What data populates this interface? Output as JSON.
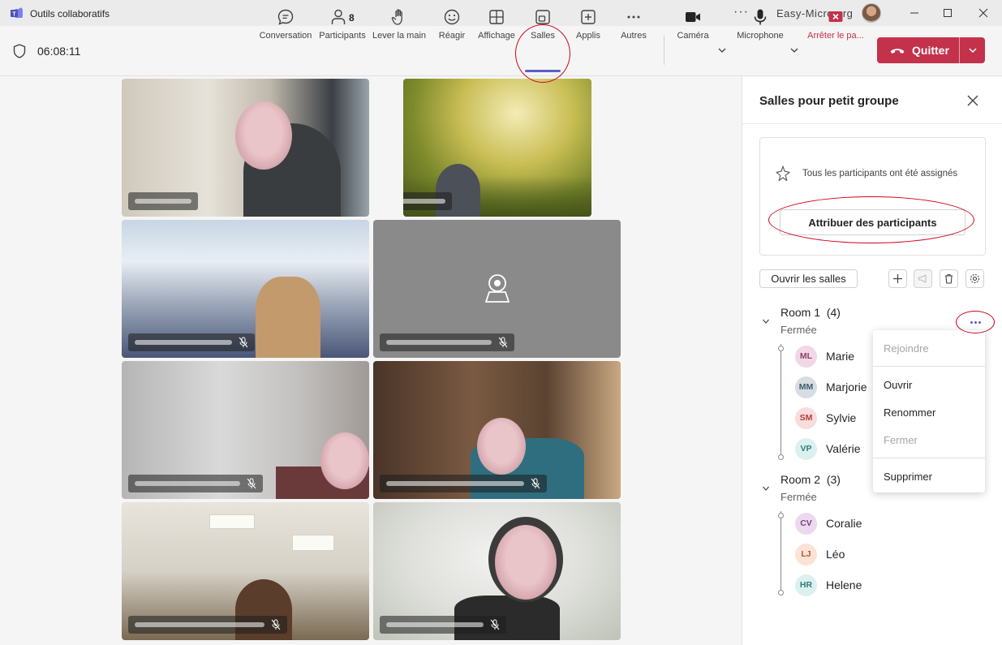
{
  "window": {
    "title": "Outils collaboratifs",
    "more_label": "···",
    "org": "Easy-Micro.org"
  },
  "toolbar": {
    "timer": "06:08:11",
    "items": [
      {
        "label": "Conversation",
        "icon": "chat-icon"
      },
      {
        "label": "Participants",
        "icon": "people-icon",
        "count": "8"
      },
      {
        "label": "Lever la main",
        "icon": "raise-hand-icon"
      },
      {
        "label": "Réagir",
        "icon": "smiley-icon"
      },
      {
        "label": "Affichage",
        "icon": "grid-view-icon"
      },
      {
        "label": "Salles",
        "icon": "breakout-rooms-icon"
      },
      {
        "label": "Applis",
        "icon": "add-apps-icon"
      },
      {
        "label": "Autres",
        "icon": "more-icon"
      },
      {
        "label": "Caméra",
        "icon": "camera-icon"
      },
      {
        "label": "Microphone",
        "icon": "microphone-icon"
      },
      {
        "label": "Arrêter le pa...",
        "icon": "stop-share-icon"
      }
    ],
    "quit_label": "Quitter",
    "accent": "#5b5fc7",
    "danger": "#c4314b"
  },
  "panel": {
    "title": "Salles pour petit groupe",
    "assigned_msg": "Tous les participants ont été assignés",
    "assign_button": "Attribuer des participants",
    "open_rooms_button": "Ouvrir les salles",
    "rooms": [
      {
        "name": "Room 1",
        "count": "(4)",
        "status": "Fermée",
        "members": [
          {
            "initials": "ML",
            "name": "Marie"
          },
          {
            "initials": "MM",
            "name": "Marjorie"
          },
          {
            "initials": "SM",
            "name": "Sylvie"
          },
          {
            "initials": "VP",
            "name": "Valérie"
          }
        ]
      },
      {
        "name": "Room 2",
        "count": "(3)",
        "status": "Fermée",
        "members": [
          {
            "initials": "CV",
            "name": "Coralie"
          },
          {
            "initials": "LJ",
            "name": "Léo"
          },
          {
            "initials": "HR",
            "name": "Helene"
          }
        ]
      }
    ]
  },
  "context_menu": {
    "items": [
      {
        "label": "Rejoindre",
        "enabled": false
      },
      {
        "label": "Ouvrir",
        "enabled": true
      },
      {
        "label": "Renommer",
        "enabled": true
      },
      {
        "label": "Fermer",
        "enabled": false
      },
      {
        "label": "Supprimer",
        "enabled": true
      }
    ]
  }
}
